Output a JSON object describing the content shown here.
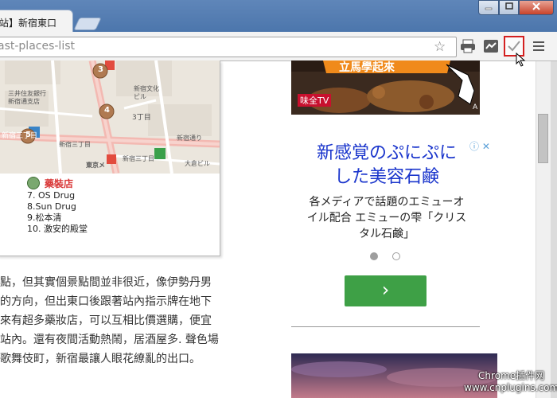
{
  "browser": {
    "tab_title": "站】新宿東口",
    "url": "ast-places-list"
  },
  "map": {
    "labels": [
      "三井住友銀行",
      "新宿通支店",
      "新宿文化",
      "ビル",
      "3丁目",
      "新宿三丁目",
      "新宿通り",
      "新宿三丁目",
      "東京メ",
      "大倉ビル",
      "新宿三丁目"
    ],
    "pins": [
      "3",
      "4",
      "5"
    ],
    "legend_title": "藥裝店",
    "legend_items": [
      "7. OS Drug",
      "8.Sun Drug",
      "9.松本清",
      "10. 激安的殿堂"
    ]
  },
  "article": {
    "lines": [
      "點，但其實個景點間並非很近，像伊勢丹男",
      "的方向，但出東口後跟著站內指示牌在地下",
      "來有超多藥妝店，可以互相比價選購，便宜",
      "站內。還有夜間活動熱鬧，居酒屋多. 聲色場",
      "歌舞伎町，新宿最讓人眼花繚亂的出口。"
    ]
  },
  "ad": {
    "top_banner_text": "立馬學起來",
    "top_brand": "味全TV",
    "top_corner": "A",
    "headline_1": "新感覚のぷにぷに",
    "headline_2": "した美容石鹸",
    "desc_1": "各メディアで話題のエミューオ",
    "desc_2": "イル配合 エミューの雫「クリス",
    "desc_3": "タル石鹸」",
    "next_glyph": "›"
  },
  "watermark": {
    "line1": "Chrome插件网",
    "line2": "www.cnplugins.com"
  },
  "colors": {
    "legend_red": "#d93737",
    "ad_blue": "#1a35cc",
    "ad_green": "#3ea046",
    "active_ext_border": "#d42020"
  }
}
